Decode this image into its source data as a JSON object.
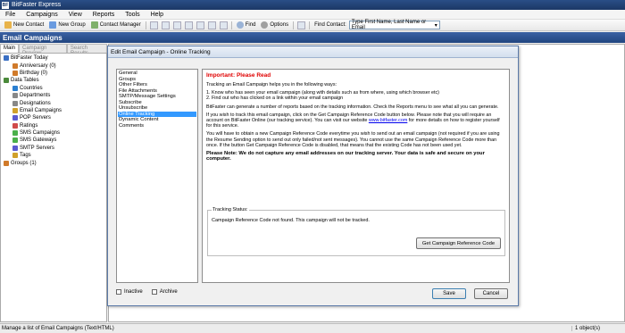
{
  "app": {
    "title": "BitFaster Express",
    "icon_label": "BF"
  },
  "menu": [
    "File",
    "Campaigns",
    "View",
    "Reports",
    "Tools",
    "Help"
  ],
  "toolbar": {
    "new_contact": "New Contact",
    "new_group": "New Group",
    "contact_manager": "Contact Manager",
    "find": "Find",
    "options": "Options",
    "find_contact_label": "Find Contact:",
    "find_contact_value": "Type First Name, Last Name or Email"
  },
  "section_title": "Email Campaigns",
  "left_tabs": [
    "Main",
    "Campaign Preview",
    "Search Results"
  ],
  "tree": [
    {
      "label": "BitFaster Today",
      "color": "#3a6fc4"
    },
    {
      "label": "Anniversary (0)",
      "color": "#d07a2a"
    },
    {
      "label": "Birthday (0)",
      "color": "#d07a2a"
    },
    {
      "label": "Data Tables",
      "color": "#4a8a3a"
    },
    {
      "label": "Countries",
      "color": "#2a7fd0"
    },
    {
      "label": "Departments",
      "color": "#888888"
    },
    {
      "label": "Designations",
      "color": "#888888"
    },
    {
      "label": "Email Campaigns",
      "color": "#d0a02a"
    },
    {
      "label": "POP Servers",
      "color": "#5a5ad0"
    },
    {
      "label": "Ratings",
      "color": "#d04a4a"
    },
    {
      "label": "SMS Campaigns",
      "color": "#4ab04a"
    },
    {
      "label": "SMS Gateways",
      "color": "#4ab04a"
    },
    {
      "label": "SMTP Servers",
      "color": "#5a5ad0"
    },
    {
      "label": "Tags",
      "color": "#d0a02a"
    },
    {
      "label": "Groups (1)",
      "color": "#d07a2a"
    }
  ],
  "dialog": {
    "title": "Edit Email Campaign - Online Tracking",
    "nav_items": [
      "General",
      "Groups",
      "Other Filters",
      "File Attachments",
      "SMTP/Message Settings",
      "Subscribe",
      "Unsubscribe",
      "Online Tracking",
      "Dynamic Content",
      "Comments"
    ],
    "heading": "Important: Please Read",
    "p1": "Tracking an Email Campaign helps you in the following ways:",
    "p2a": "1. Know who has seen your email campaign (along with details such as from where, using which browser etc)",
    "p2b": "2. Find out who has clicked on a link within your email campaign",
    "p3": "BitFaster can generate a number of reports based on the tracking information. Check the Reports menu to see what all you can generate.",
    "p4_pre": "If you wish to track this email campaign, click on the Get Campaign Reference Code button below. Please note that you will require an account on BitFaster Online (our tracking service). You can visit our website ",
    "p4_link": "www.bitfaster.com",
    "p4_post": " for more details on how to register yourself for this service.",
    "p5": "You will have to obtain a new Campaign Reference Code everytime you wish to send out an email campaign (not required if you are using the Resume Sending option to send out only failed/not sent messages). You cannot use the same Campaign Reference Code more than once. If the button Get Campaign Reference Code is disabled, that means that the existing Code has not been used yet.",
    "p6": "Please Note: We do not capture any email addresses on our tracking server. Your data is safe and secure on your computer.",
    "tracking_status_label": "Tracking Status:",
    "tracking_status_text": "Campaign Reference Code not found. This campaign will not be tracked.",
    "get_code_button": "Get Campaign Reference Code",
    "inactive_label": "Inactive",
    "archive_label": "Archive",
    "save_button": "Save",
    "cancel_button": "Cancel"
  },
  "status": {
    "text": "Manage a list of Email Campaigns (Text/HTML)",
    "count": "1 object(s)"
  }
}
